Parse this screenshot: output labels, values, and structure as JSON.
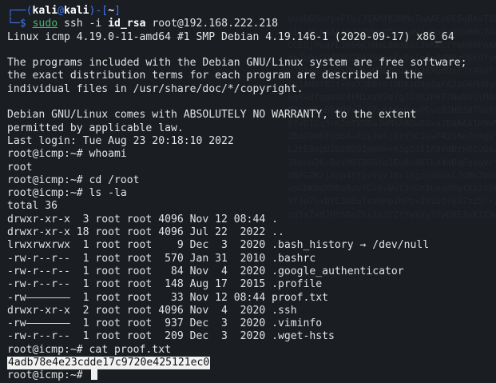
{
  "prompt": {
    "user": "kali",
    "host": "kali",
    "at": "@",
    "path": "~",
    "prefix": "┌──(",
    "between": ")-[",
    "suffix": "]",
    "dollar": "└─$ "
  },
  "command": {
    "sudo": "sudo",
    "ssh": " ssh -i ",
    "key": "id_rsa",
    "target": " root@192.168.222.218"
  },
  "output": [
    "Linux icmp 4.19.0-11-amd64 #1 SMP Debian 4.19.146-1 (2020-09-17) x86_64",
    "",
    "The programs included with the Debian GNU/Linux system are free software;",
    "the exact distribution terms for each program are described in the",
    "individual files in /usr/share/doc/*/copyright.",
    "",
    "Debian GNU/Linux comes with ABSOLUTELY NO WARRANTY, to the extent",
    "permitted by applicable law.",
    "Last login: Tue Aug 23 20:18:10 2022",
    "root@icmp:~# whoami",
    "root",
    "root@icmp:~# cd /root",
    "root@icmp:~# ls -la",
    "total 36",
    "drwxr-xr-x  3 root root 4096 Nov 12 08:44 .",
    "drwxr-xr-x 18 root root 4096 Jul 22  2022 ..",
    "lrwxrwxrwx  1 root root    9 Dec  3  2020 .bash_history → /dev/null",
    "-rw-r--r--  1 root root  570 Jan 31  2010 .bashrc",
    "-rw-r--r--  1 root root   84 Nov  4  2020 .google_authenticator",
    "-rw-r--r--  1 root root  148 Aug 17  2015 .profile",
    "-rw———————  1 root root   33 Nov 12 08:44 proof.txt",
    "drwxr-xr-x  2 root root 4096 Nov  4  2020 .ssh",
    "-rw———————  1 root root  937 Dec  3  2020 .viminfo",
    "-rw-r--r--  1 root root  209 Dec  3  2020 .wget-hsts",
    "root@icmp:~# cat proof.txt"
  ],
  "proof_hash": "4adb78e4e23cdde17c9720e425121ec0",
  "final_prompt": "root@icmp:~#"
}
